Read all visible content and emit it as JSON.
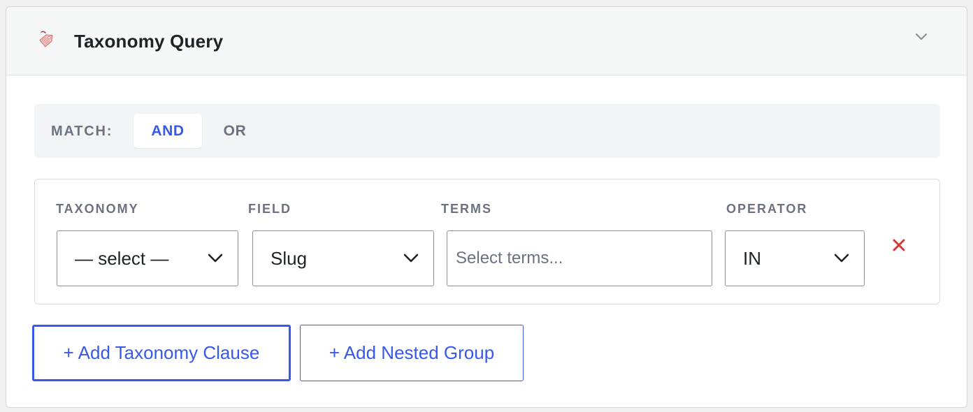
{
  "panel": {
    "title": "Taxonomy Query",
    "icon": "tag-icon",
    "collapse_icon": "chevron-down-icon"
  },
  "match": {
    "label": "MATCH:",
    "options": [
      "AND",
      "OR"
    ],
    "selected": "AND"
  },
  "clause": {
    "columns": {
      "taxonomy": "TAXONOMY",
      "field": "FIELD",
      "terms": "TERMS",
      "operator": "OPERATOR"
    },
    "taxonomy_value": "— select —",
    "field_value": "Slug",
    "terms_placeholder": "Select terms...",
    "terms_value": "",
    "operator_value": "IN",
    "remove_icon": "close-icon"
  },
  "actions": {
    "add_clause": "+ Add Taxonomy Clause",
    "add_group": "+ Add Nested Group"
  },
  "colors": {
    "accent": "#3858e9",
    "danger": "#d63638",
    "muted": "#6b7280",
    "text": "#1d2327"
  }
}
